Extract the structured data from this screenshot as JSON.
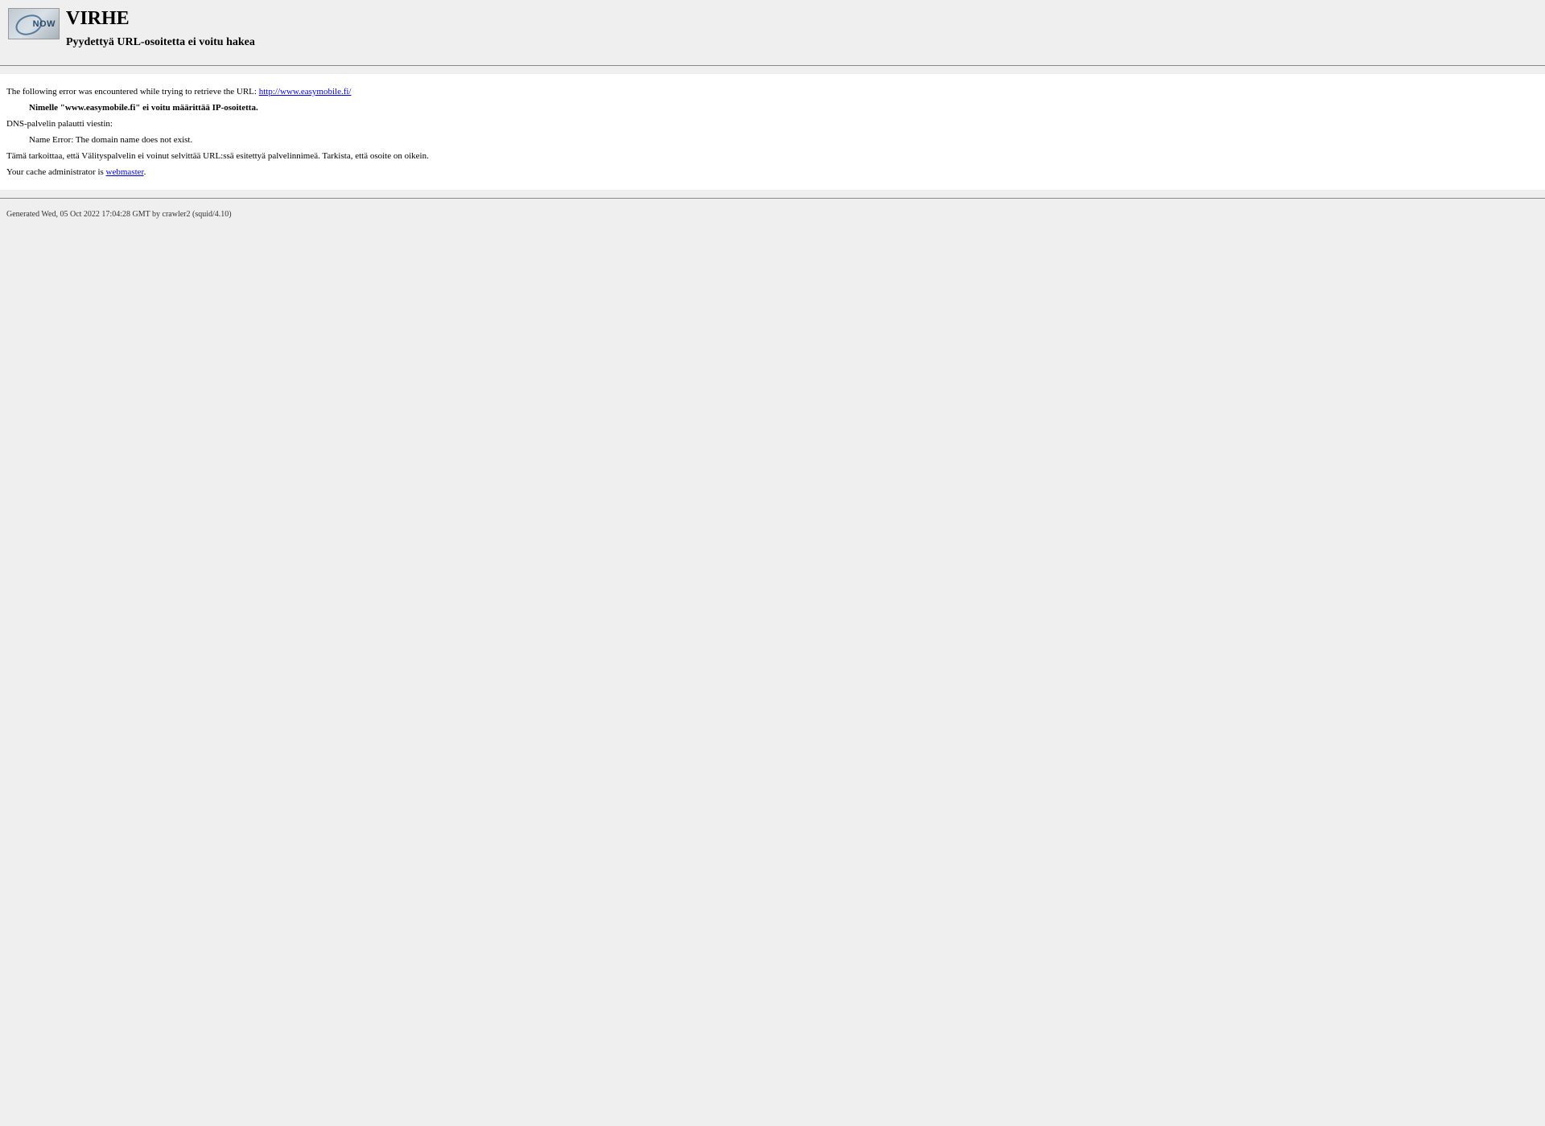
{
  "header": {
    "logo_text": "NOW",
    "title": "VIRHE",
    "subtitle": "Pyydettyä URL-osoitetta ei voitu hakea"
  },
  "content": {
    "error_intro": "The following error was encountered while trying to retrieve the URL: ",
    "url_link": "http://www.easymobile.fi/",
    "dns_error": "Nimelle \"www.easymobile.fi\" ei voitu määrittää IP-osoitetta.",
    "dns_server_label": "DNS-palvelin palautti viestin:",
    "name_error": "Name Error: The domain name does not exist.",
    "explanation": "Tämä tarkoittaa, että Välityspalvelin ei voinut selvittää URL:ssä esitettyä palvelinnimeä. Tarkista, että osoite on oikein.",
    "admin_intro": "Your cache administrator is ",
    "admin_link": "webmaster",
    "admin_period": "."
  },
  "footer": {
    "generated": "Generated Wed, 05 Oct 2022 17:04:28 GMT by crawler2 (squid/4.10)"
  }
}
